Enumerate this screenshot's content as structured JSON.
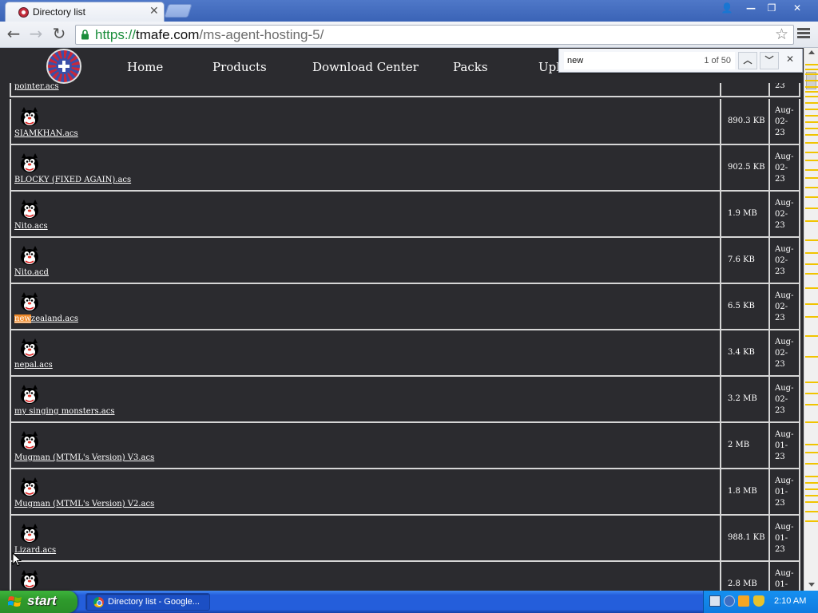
{
  "browser": {
    "tab_title": "Directory list",
    "tab_close": "✕",
    "window_buttons": {
      "user": "👤",
      "minimize": "—",
      "maximize": "❐",
      "close": "✕"
    },
    "url_scheme": "https://",
    "url_host": "tmafe.com",
    "url_path": "/ms-agent-hosting-5/"
  },
  "site_nav": {
    "items": [
      "Home",
      "Products",
      "Download Center",
      "Packs",
      "Upload"
    ]
  },
  "find_bar": {
    "query": "new",
    "count": "1 of 50"
  },
  "files_partial_top": {
    "name": "pointer.acs",
    "size": "",
    "date": "23"
  },
  "files": [
    {
      "name": "SIAMKHAN.acs",
      "size": "890.3 KB",
      "date": "Aug-02-23"
    },
    {
      "name": "BLOCKY (FIXED AGAIN).acs",
      "size": "902.5 KB",
      "date": "Aug-02-23"
    },
    {
      "name": "Nito.acs",
      "size": "1.9 MB",
      "date": "Aug-02-23"
    },
    {
      "name": "Nito.acd",
      "size": "7.6 KB",
      "date": "Aug-02-23"
    },
    {
      "name_highlight": "new",
      "name_rest": "zealand.acs",
      "size": "6.5 KB",
      "date": "Aug-02-23"
    },
    {
      "name": "nepal.acs",
      "size": "3.4 KB",
      "date": "Aug-02-23"
    },
    {
      "name": "my singing monsters.acs",
      "size": "3.2 MB",
      "date": "Aug-02-23"
    },
    {
      "name": "Mugman (MTML's Version) V3.acs",
      "size": "2 MB",
      "date": "Aug-01-23"
    },
    {
      "name": "Mugman (MTML's Version) V2.acs",
      "size": "1.8 MB",
      "date": "Aug-01-23"
    },
    {
      "name": "Lizard.acs",
      "size": "988.1 KB",
      "date": "Aug-01-23"
    },
    {
      "name": "",
      "size": "2.8 MB",
      "date": "Aug-01-"
    }
  ],
  "taskbar": {
    "start_label": "start",
    "task_label": "Directory list - Google...",
    "clock": "2:10 AM"
  },
  "colors": {
    "page_bg": "#2b2b2f",
    "find_highlight": "#f08a2a",
    "scroll_marks": "#f0c400",
    "url_scheme": "#1a8d3b"
  }
}
